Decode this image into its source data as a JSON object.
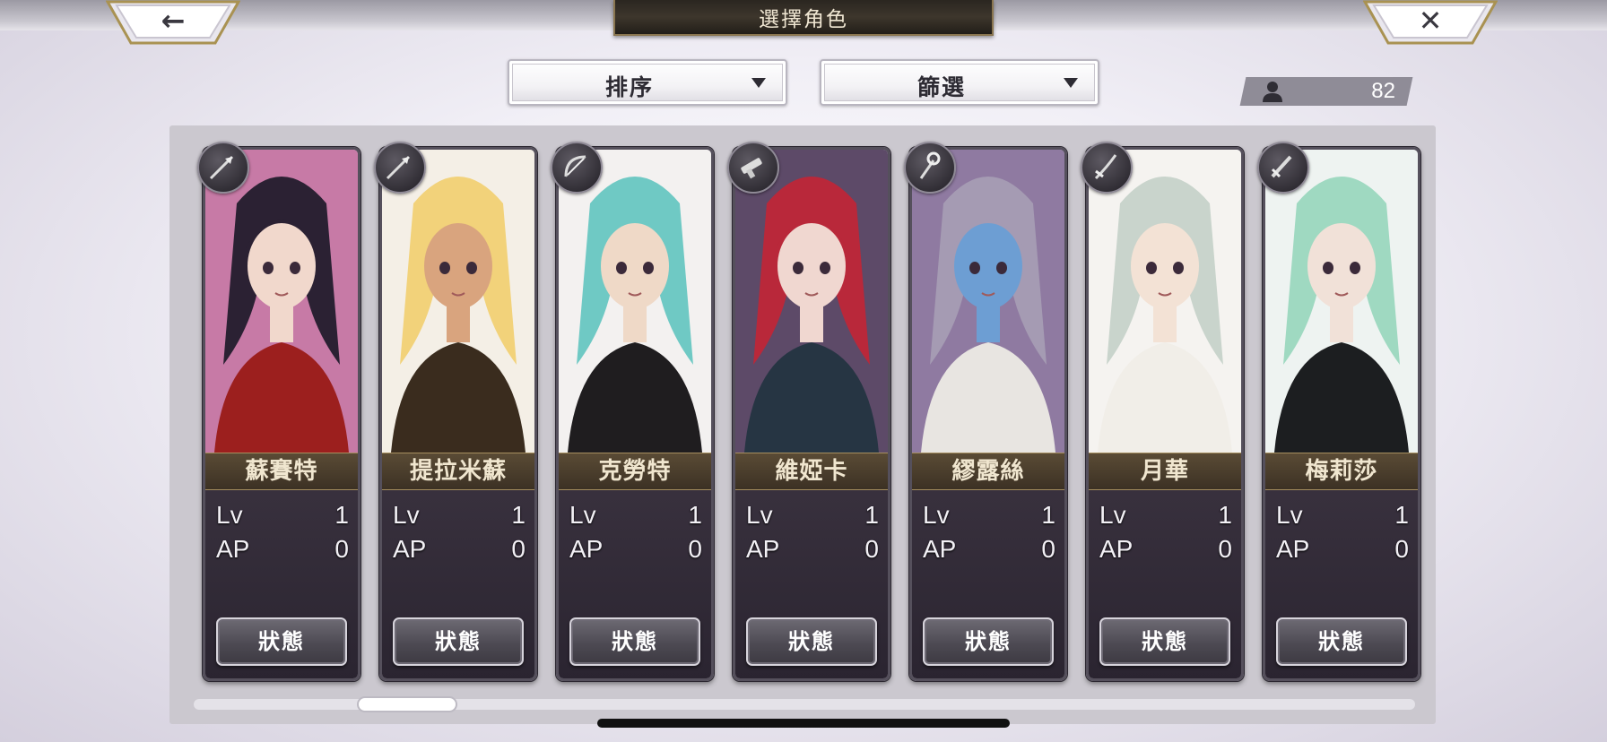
{
  "header": {
    "title": "選擇角色",
    "back_glyph": "←",
    "close_glyph": "✕"
  },
  "controls": {
    "sort_label": "排序",
    "filter_label": "篩選",
    "count_value": "82"
  },
  "characters": [
    {
      "name": "蘇賽特",
      "lv_label": "Lv",
      "lv": "1",
      "ap_label": "AP",
      "ap": "0",
      "status_label": "狀態",
      "weapon_icon": "spear-icon",
      "hair": "#2b2133",
      "skin": "#f1d8cc",
      "outfit": "#9c1f1e",
      "bg": "#c77aa6"
    },
    {
      "name": "提拉米蘇",
      "lv_label": "Lv",
      "lv": "1",
      "ap_label": "AP",
      "ap": "0",
      "status_label": "狀態",
      "weapon_icon": "spear-icon",
      "hair": "#f2d27a",
      "skin": "#d9a47e",
      "outfit": "#3a2c1e",
      "bg": "#f4efe6"
    },
    {
      "name": "克勞特",
      "lv_label": "Lv",
      "lv": "1",
      "ap_label": "AP",
      "ap": "0",
      "status_label": "狀態",
      "weapon_icon": "bow-icon",
      "hair": "#6fc9c4",
      "skin": "#efd9c7",
      "outfit": "#1f1d1f",
      "bg": "#f3f1f0"
    },
    {
      "name": "維婭卡",
      "lv_label": "Lv",
      "lv": "1",
      "ap_label": "AP",
      "ap": "0",
      "status_label": "狀態",
      "weapon_icon": "gun-icon",
      "hair": "#b9283a",
      "skin": "#f0d7d0",
      "outfit": "#263543",
      "bg": "#5d4a68"
    },
    {
      "name": "繆露絲",
      "lv_label": "Lv",
      "lv": "1",
      "ap_label": "AP",
      "ap": "0",
      "status_label": "狀態",
      "weapon_icon": "staff-icon",
      "hair": "#a59bb3",
      "skin": "#6d9ed3",
      "outfit": "#e8e5e1",
      "bg": "#8f7aa1"
    },
    {
      "name": "月華",
      "lv_label": "Lv",
      "lv": "1",
      "ap_label": "AP",
      "ap": "0",
      "status_label": "狀態",
      "weapon_icon": "katana-icon",
      "hair": "#c9d4cc",
      "skin": "#f3e2d5",
      "outfit": "#f1eee8",
      "bg": "#f5f3f0"
    },
    {
      "name": "梅莉莎",
      "lv_label": "Lv",
      "lv": "1",
      "ap_label": "AP",
      "ap": "0",
      "status_label": "狀態",
      "weapon_icon": "sword-icon",
      "hair": "#9fd9c1",
      "skin": "#f1e1d8",
      "outfit": "#1c1e20",
      "bg": "#eef3f1"
    }
  ]
}
